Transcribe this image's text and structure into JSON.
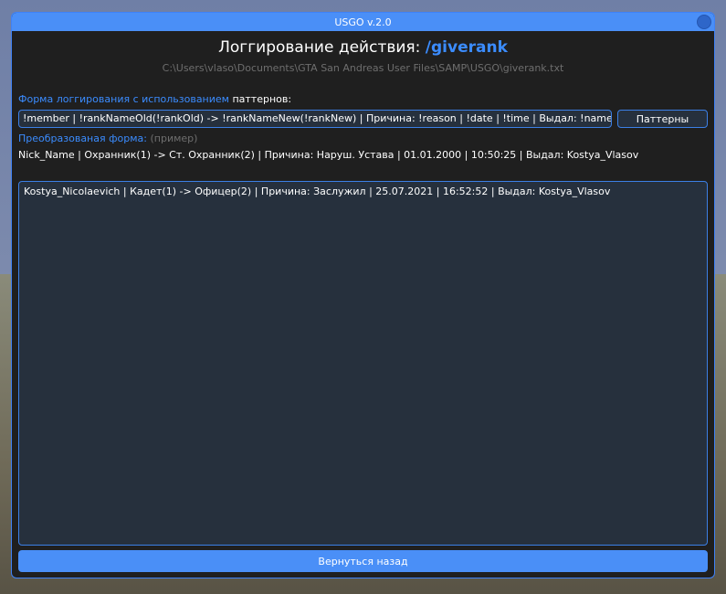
{
  "window": {
    "title": "USGO v.2.0"
  },
  "header": {
    "title_prefix": "Логгирование действия:",
    "command": "/giverank",
    "file_path": "C:\\Users\\vlaso\\Documents\\GTA San Andreas User Files\\SAMP\\USGO\\giverank.txt"
  },
  "form": {
    "label_blue": "Форма логгирования с использованием",
    "label_white": "паттернов:",
    "pattern_value": "!member | !rankNameOld(!rankOld) -> !rankNameNew(!rankNew) | Причина: !reason | !date | !time | Выдал: !name",
    "patterns_button": "Паттерны"
  },
  "converted": {
    "label_blue": "Преобразованая форма:",
    "label_gray": "(пример)",
    "example": "Nick_Name | Охранник(1) -> Ст. Охранник(2) | Причина: Наруш. Устава | 01.01.2000 | 10:50:25 | Выдал: Kostya_Vlasov"
  },
  "log": {
    "lines": [
      "Kostya_Nicolaevich | Кадет(1) -> Офицер(2) | Причина: Заслужил | 25.07.2021 | 16:52:52 | Выдал: Kostya_Vlasov"
    ]
  },
  "footer": {
    "back_button": "Вернуться назад"
  },
  "colors": {
    "accent": "#4a8ff7",
    "accent_text": "#3b8cff",
    "panel": "#1f1f1f",
    "field": "#26303d"
  }
}
